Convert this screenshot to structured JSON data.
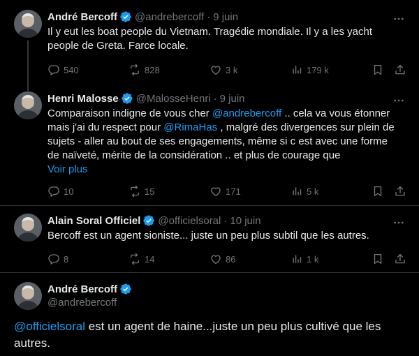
{
  "tweets": [
    {
      "name": "André Bercoff",
      "handle": "@andrebercoff",
      "dot": "·",
      "date": "9 juin",
      "text": "Il y eut les boat people du Vietnam. Tragédie mondiale. Il y a les yacht people de Greta. Farce locale.",
      "replies": "540",
      "retweets": "828",
      "likes": "3 k",
      "views": "179 k"
    },
    {
      "name": "Henri Malosse",
      "handle": "@MalosseHenri",
      "dot": "·",
      "date": "9 juin",
      "text_pre": "Comparaison indigne de vous cher ",
      "mention1": "@andrebercoff",
      "text_mid": " .. cela va vous étonner mais j'ai du respect pour ",
      "mention2": "@RimaHas",
      "text_post": " , malgré des divergences sur plein de sujets - aller au bout de ses engagements, même si c est avec une forme de naïveté, mérite de la considération .. et plus de courage que",
      "show_more": "Voir plus",
      "replies": "10",
      "retweets": "15",
      "likes": "171",
      "views": "5 k"
    },
    {
      "name": "Alain Soral Officiel",
      "handle": "@officielsoral",
      "dot": "·",
      "date": "10 juin",
      "text": "Bercoff est un agent sioniste... juste un peu plus subtil que les autres.",
      "replies": "8",
      "retweets": "14",
      "likes": "86",
      "views": "1 k"
    }
  ],
  "main_tweet": {
    "name": "André Bercoff",
    "handle": "@andrebercoff",
    "mention": "@officielsoral",
    "text": " est un agent de haine...juste un peu plus cultivé que les autres."
  },
  "colors": {
    "background": "#000000",
    "text": "#e7e9ea",
    "muted": "#71767b",
    "link": "#1d9bf0",
    "verified": "#1d9bf0"
  },
  "icons": [
    "verified-badge-icon",
    "more-icon",
    "reply-icon",
    "retweet-icon",
    "like-icon",
    "views-icon",
    "bookmark-icon",
    "share-icon"
  ]
}
